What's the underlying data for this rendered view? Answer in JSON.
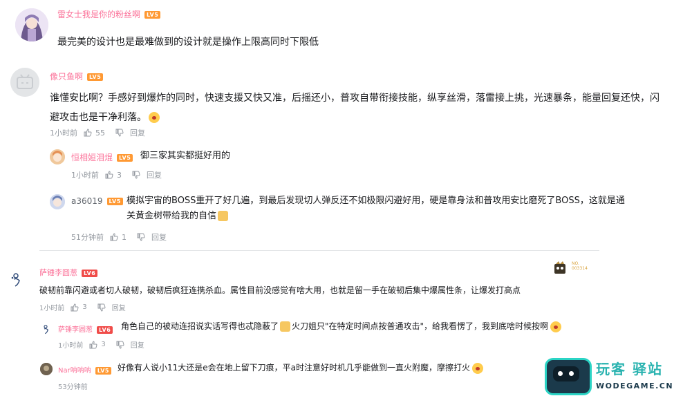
{
  "comments": [
    {
      "user": "雷女士我是你的粉丝啊",
      "level": "LV5",
      "text": "最完美的设计也是最难做到的设计就是操作上限高同时下限低"
    },
    {
      "user": "像只鱼啊",
      "level": "LV5",
      "text_line1": "谁懂安比啊？手感好到爆炸的同时，快速支援又快又准，后摇还小，普攻自带衔接技能，纵享丝滑，落雷接上挑，光速暴条，能量回复还快，闪",
      "text_line2": "避攻击也是干净利落。",
      "time": "1小时前",
      "likes": "55",
      "reply_label": "回复",
      "replies": [
        {
          "user": "恒相姮泪焜",
          "level": "LV5",
          "text": "御三家其实都挺好用的",
          "time": "1小时前",
          "likes": "3",
          "reply_label": "回复"
        },
        {
          "user": "a36019",
          "level": "LV5",
          "text_line1": "模拟宇宙的BOSS重开了好几遍，到最后发现切人弹反还不如极限闪避好用，硬是靠身法和普攻用安比磨死了BOSS，这就是通",
          "text_line2": "关黄金树带给我的自信",
          "time": "51分钟前",
          "likes": "1",
          "reply_label": "回复"
        }
      ]
    },
    {
      "user": "萨锤李圆葱",
      "level": "LV6",
      "badge_text": "NO.",
      "badge_num": "003314",
      "text": "破韧前靠闪避或者切人破韧，破韧后疯狂连携杀血。属性目前没感觉有啥大用，也就是留一手在破韧后集中爆属性条，让爆发打高点",
      "time": "1小时前",
      "likes": "3",
      "reply_label": "回复",
      "replies": [
        {
          "user": "萨锤李圆葱",
          "level": "LV6",
          "text_a": "角色自己的被动连招说实话写得也忒隐蔽了",
          "text_b": "火刀姐只\"在特定时间点按普通攻击\"，给我看愣了，我到底啥时候按啊",
          "time": "1小时前",
          "likes": "3",
          "reply_label": "回复"
        },
        {
          "user": "Nar呐呐呐",
          "level": "LV5",
          "text": "好像有人说小11大还是e会在地上留下刀痕，平a时注意好时机几乎能做到一直火附魔，摩擦打火",
          "time": "53分钟前"
        }
      ]
    }
  ],
  "watermark": {
    "cn": "玩客 驿站",
    "en": "WODEGAME.CN"
  },
  "colors": {
    "username_pink": "#fb7299",
    "meta_gray": "#9499a0",
    "divider": "#e3e5e7",
    "watermark_teal": "#2bd4c5"
  }
}
